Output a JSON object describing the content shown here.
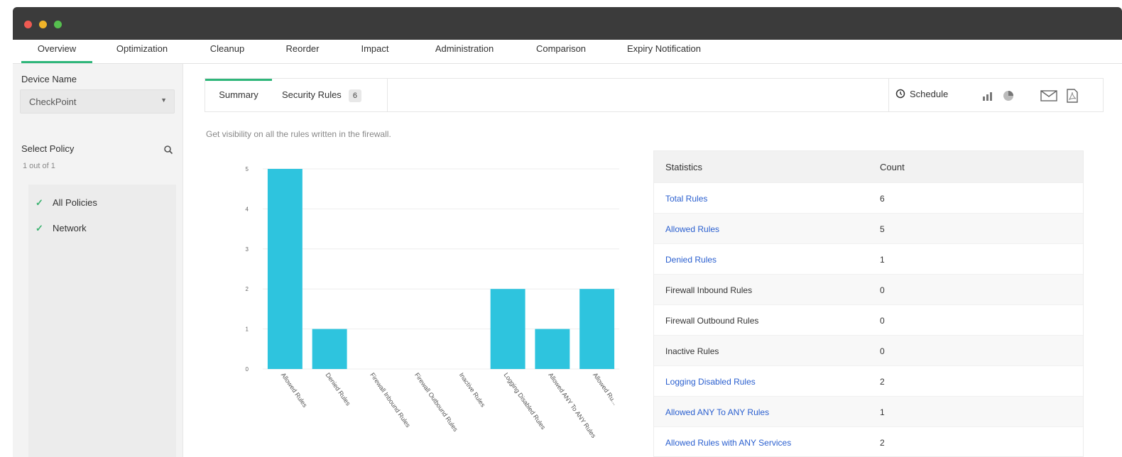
{
  "nav": {
    "items": [
      {
        "label": "Overview"
      },
      {
        "label": "Optimization"
      },
      {
        "label": "Cleanup"
      },
      {
        "label": "Reorder"
      },
      {
        "label": "Impact"
      },
      {
        "label": "Administration"
      },
      {
        "label": "Comparison"
      },
      {
        "label": "Expiry Notification"
      }
    ],
    "active": "Overview"
  },
  "sidebar": {
    "device_label": "Device Name",
    "device_value": "CheckPoint",
    "policy_label": "Select Policy",
    "policy_count": "1 out of 1",
    "policies": [
      {
        "label": "All Policies",
        "checked": true
      },
      {
        "label": "Network",
        "checked": true
      }
    ]
  },
  "tabs": {
    "summary": "Summary",
    "security_rules": "Security Rules",
    "security_rules_badge": "6",
    "schedule": "Schedule"
  },
  "description": "Get visibility on all the rules written in the firewall.",
  "chart_data": {
    "type": "bar",
    "categories": [
      "Allowed Rules",
      "Denied Rules",
      "Firewall Inbound Rules",
      "Firewall Outbound Rules",
      "Inactive Rules",
      "Logging Disabled Rules",
      "Allowed ANY To ANY Rules",
      "Allowed Ru..."
    ],
    "values": [
      5,
      1,
      0,
      0,
      0,
      2,
      1,
      2
    ],
    "yticks": [
      0,
      1,
      2,
      3,
      4,
      5
    ],
    "ylim": [
      0,
      5
    ],
    "grid": true,
    "color": "#2ec4de"
  },
  "stats": {
    "header_statistics": "Statistics",
    "header_count": "Count",
    "rows": [
      {
        "label": "Total Rules",
        "count": "6",
        "link": true
      },
      {
        "label": "Allowed Rules",
        "count": "5",
        "link": true
      },
      {
        "label": "Denied Rules",
        "count": "1",
        "link": true
      },
      {
        "label": "Firewall Inbound Rules",
        "count": "0",
        "link": false
      },
      {
        "label": "Firewall Outbound Rules",
        "count": "0",
        "link": false
      },
      {
        "label": "Inactive Rules",
        "count": "0",
        "link": false
      },
      {
        "label": "Logging Disabled Rules",
        "count": "2",
        "link": true
      },
      {
        "label": "Allowed ANY To ANY Rules",
        "count": "1",
        "link": true
      },
      {
        "label": "Allowed Rules with ANY Services",
        "count": "2",
        "link": true
      }
    ]
  },
  "colors": {
    "accent": "#2fb67a",
    "titlebar": "#3b3b3b",
    "link": "#2a5fcf",
    "bar": "#2ec4de"
  }
}
